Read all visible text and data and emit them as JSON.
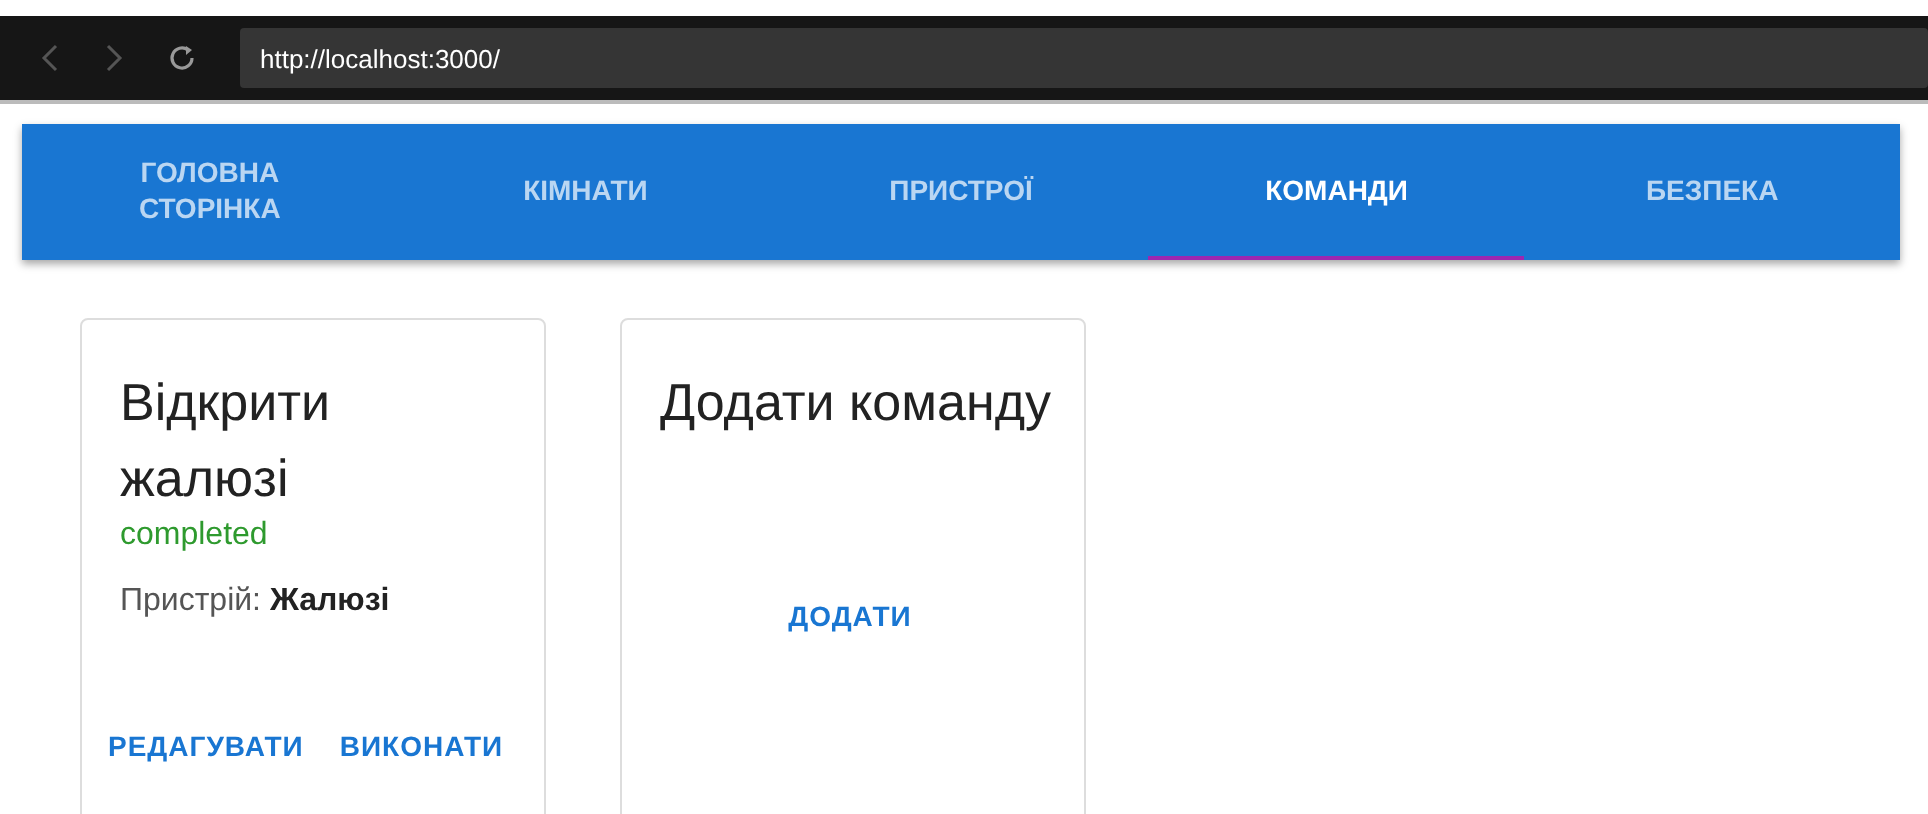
{
  "browser": {
    "url": "http://localhost:3000/"
  },
  "tabs": [
    {
      "label": "ГОЛОВНА СТОРІНКА",
      "selected": false
    },
    {
      "label": "КІМНАТИ",
      "selected": false
    },
    {
      "label": "ПРИСТРОЇ",
      "selected": false
    },
    {
      "label": "КОМАНДИ",
      "selected": true
    },
    {
      "label": "БЕЗПЕКА",
      "selected": false
    }
  ],
  "commands": [
    {
      "title": "Відкрити жалюзі",
      "status": "completed",
      "device": "Пристрій: **Жалюзі**",
      "actions": [
        "РЕДАГУВАТИ",
        "ВИКОНАТИ"
      ]
    }
  ],
  "add_card": {
    "title": "Додати команду",
    "action": "ДОДАТИ"
  }
}
